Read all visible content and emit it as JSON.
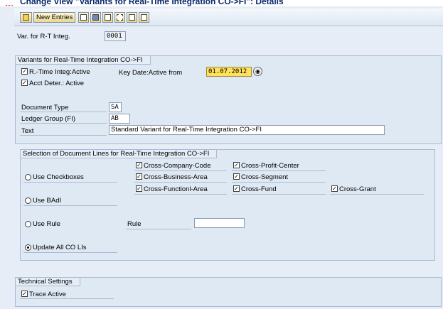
{
  "window": {
    "title": "Change View \"Variants for Real-Time Integration CO->FI\": Details"
  },
  "toolbar": {
    "new_entries": "New Entries"
  },
  "header": {
    "variant_label": "Var. for R-T Integ.",
    "variant_value": "0001"
  },
  "variants": {
    "title": "Variants for Real-Time Integration CO->FI",
    "rt_integ_label": "R.-Time Integ:Active",
    "rt_integ_checked": true,
    "acct_deter_label": "Acct Deter.: Active",
    "acct_deter_checked": true,
    "key_date_label": "Key Date:Active from",
    "key_date_value": "01.07.2012",
    "doc_type_label": "Document Type",
    "doc_type_value": "SA",
    "ledger_group_label": "Ledger Group (FI)",
    "ledger_group_value": "AB",
    "text_label": "Text",
    "text_value": "Standard Variant for Real-Time Integration CO->FI"
  },
  "selection": {
    "title": "Selection of Document Lines for Real-Time Integration CO->FI",
    "use_checkboxes": "Use Checkboxes",
    "use_badi": "Use BAdI",
    "use_rule": "Use Rule",
    "update_all": "Update All CO LIs",
    "rule_label": "Rule",
    "rule_value": "",
    "cross_company_code": "Cross-Company-Code",
    "cross_profit_center": "Cross-Profit-Center",
    "cross_business_area": "Cross-Business-Area",
    "cross_segment": "Cross-Segment",
    "cross_functional_area": "Cross-Functionl-Area",
    "cross_fund": "Cross-Fund",
    "cross_grant": "Cross-Grant",
    "selected_option": "Update All CO LIs"
  },
  "technical": {
    "title": "Technical Settings",
    "trace_label": "Trace Active",
    "trace_checked": true
  },
  "icons": [
    "display-change-icon",
    "copy-icon",
    "save-icon",
    "undo-icon",
    "select-all-icon",
    "deselect-icon",
    "transport-icon"
  ],
  "colors": {
    "key_date_bg": "#ffe15a",
    "title": "#0a2a6b"
  }
}
